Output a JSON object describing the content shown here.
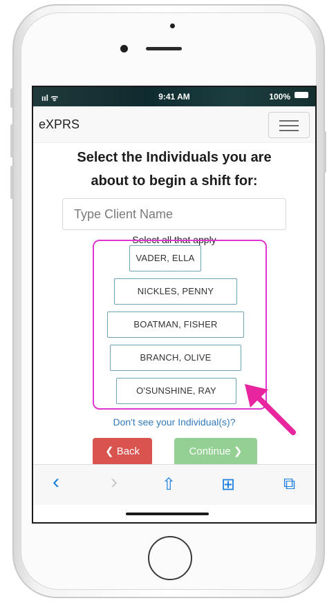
{
  "status": {
    "signal": "ııl ᯤ",
    "time": "9:41 AM",
    "battery": "100%"
  },
  "nav": {
    "brand": "eXPRS"
  },
  "heading": {
    "line1": "Select the Individuals you are",
    "line2": "about to begin a shift for:"
  },
  "search": {
    "placeholder": "Type Client Name"
  },
  "hint": "Select all that apply",
  "individuals": [
    "VADER, ELLA",
    "NICKLES, PENNY",
    "BOATMAN, FISHER",
    "BRANCH, OLIVE",
    "O'SUNSHINE, RAY"
  ],
  "link": "Don't see your Individual(s)?",
  "buttons": {
    "back": "Back",
    "continue": "Continue"
  },
  "toolbar": {
    "back_icon": "‹",
    "forward_icon": "›",
    "share_icon": "⇧",
    "bookmarks_icon": "⊞",
    "tabs_icon": "⧉"
  },
  "colors": {
    "highlight": "#e034d0",
    "back": "#d9534f",
    "continue": "#5cb85c",
    "link": "#337ab7",
    "toolbar_icons": "#1a7fe0"
  }
}
